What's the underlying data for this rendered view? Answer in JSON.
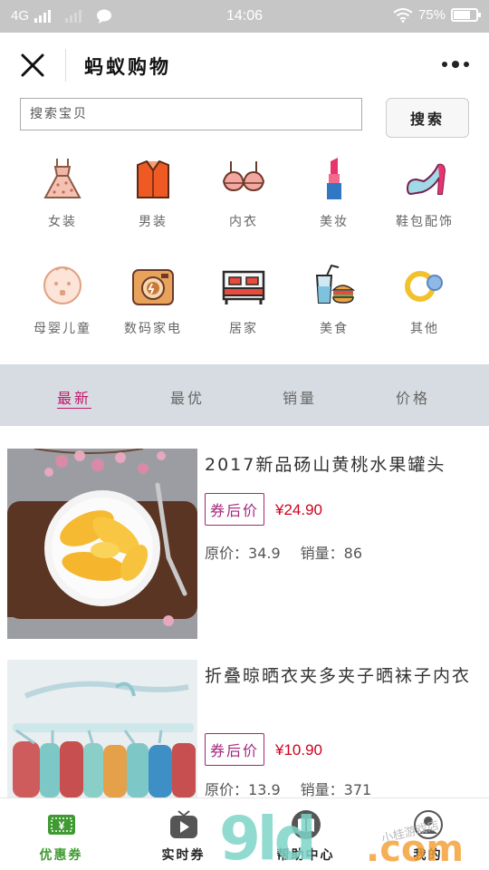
{
  "status_bar": {
    "network": "4G",
    "time": "14:06",
    "battery": "75%",
    "battery_level": 0.75
  },
  "header": {
    "title": "蚂蚁购物"
  },
  "search": {
    "placeholder": "搜索宝贝",
    "button_label": "搜索"
  },
  "categories": [
    {
      "label": "女装",
      "icon": "dress-icon"
    },
    {
      "label": "男装",
      "icon": "shirt-icon"
    },
    {
      "label": "内衣",
      "icon": "bra-icon"
    },
    {
      "label": "美妆",
      "icon": "lipstick-icon"
    },
    {
      "label": "鞋包配饰",
      "icon": "high-heel-icon"
    },
    {
      "label": "母婴儿童",
      "icon": "baby-icon"
    },
    {
      "label": "数码家电",
      "icon": "camera-icon"
    },
    {
      "label": "居家",
      "icon": "bed-icon"
    },
    {
      "label": "美食",
      "icon": "food-icon"
    },
    {
      "label": "其他",
      "icon": "rings-icon"
    }
  ],
  "sort_tabs": [
    {
      "label": "最新",
      "active": true
    },
    {
      "label": "最优",
      "active": false
    },
    {
      "label": "销量",
      "active": false
    },
    {
      "label": "价格",
      "active": false
    }
  ],
  "products": [
    {
      "title": "2017新品砀山黄桃水果罐头",
      "coupon_label": "券后价",
      "price": "¥24.90",
      "original_label": "原价：",
      "original": "34.9",
      "sales_label": "销量：",
      "sales": "86"
    },
    {
      "title": "折叠晾晒衣夹多夹子晒袜子内衣",
      "coupon_label": "券后价",
      "price": "¥10.90",
      "original_label": "原价：",
      "original": "13.9",
      "sales_label": "销量：",
      "sales": "371"
    }
  ],
  "tabbar": [
    {
      "label": "优惠券",
      "icon": "coupon-icon",
      "active": true
    },
    {
      "label": "实时券",
      "icon": "tv-play-icon",
      "active": false
    },
    {
      "label": "帮助中心",
      "icon": "book-icon",
      "active": false
    },
    {
      "label": "我的",
      "icon": "profile-icon",
      "active": false
    }
  ],
  "watermark": {
    "text": "9ld.com",
    "caption": "小桂游戏店"
  },
  "colors": {
    "active_tab": "#c2186d",
    "price": "#d0021b",
    "coupon": "#a3267a",
    "tab_active": "#3f9a31",
    "status_bar": "#c6c6c6",
    "sort_bar": "#d7dce2"
  }
}
